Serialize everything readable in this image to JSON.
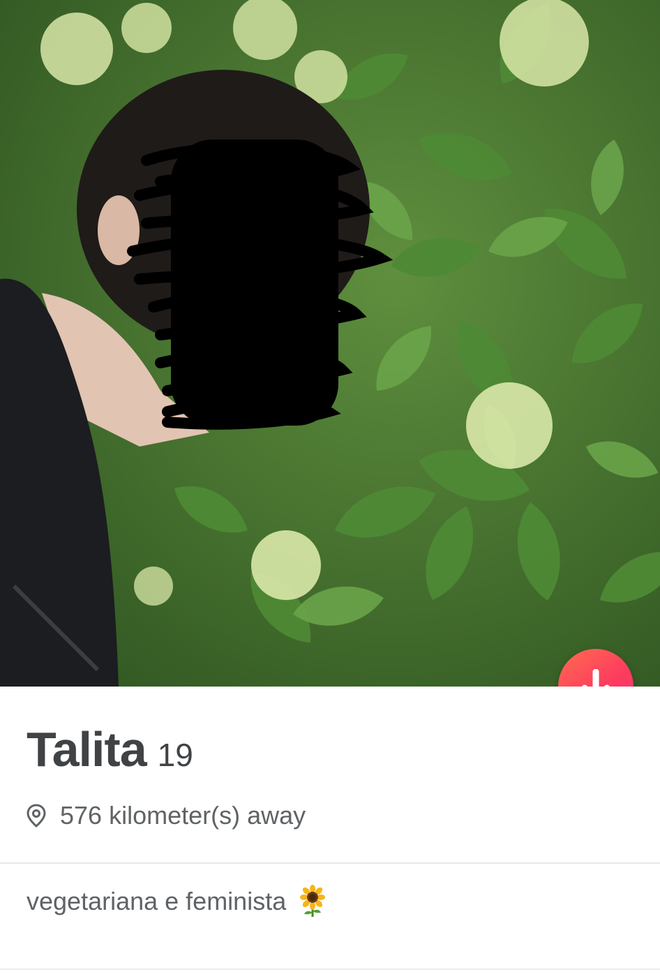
{
  "profile": {
    "name": "Talita",
    "age": "19",
    "distance": "576 kilometer(s) away",
    "bio": "vegetariana e feminista",
    "bio_emoji": "sunflower-icon"
  },
  "icons": {
    "location": "location-pin-icon",
    "action_button": "arrow-down-icon"
  },
  "colors": {
    "action_button_gradient": [
      "#ff6d4f",
      "#fd3b5f",
      "#f2337a"
    ],
    "name_text": "#404345",
    "secondary_text": "#5f6366"
  }
}
